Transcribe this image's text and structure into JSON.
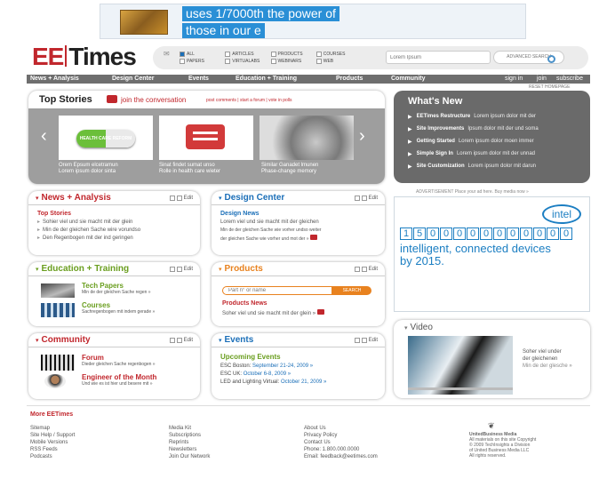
{
  "ad_banner": {
    "line1": "uses 1/7000th the power of",
    "line2": "those in our e"
  },
  "logo": {
    "part1": "EE",
    "part2": "Times"
  },
  "search_filters": [
    {
      "label": "ALL",
      "checked": true
    },
    {
      "label": "ARTICLES",
      "checked": false
    },
    {
      "label": "PRODUCTS",
      "checked": false
    },
    {
      "label": "COURSES",
      "checked": false
    },
    {
      "label": "PAPERS",
      "checked": false
    },
    {
      "label": "VIRTUALABS",
      "checked": false
    },
    {
      "label": "WEBINARS",
      "checked": false
    },
    {
      "label": "WEB",
      "checked": false
    }
  ],
  "search": {
    "placeholder": "Lorem Ipsum",
    "advanced_label": "ADVANCED SEARCH"
  },
  "nav": {
    "items": [
      "News + Analysis",
      "Design Center",
      "Events",
      "Education + Training",
      "Products",
      "Community"
    ],
    "sign_in": "sign in",
    "join": "join",
    "subscribe": "subscribe",
    "reset": "RESET HOMEPAGE"
  },
  "top_stories": {
    "title": "Top Stories",
    "join_label": "join the conversation",
    "join_links": "post comments | start a forum | vote in polls",
    "items": [
      {
        "line1": "Orem Epsum elcetramun",
        "line2": "Lorem ipsum dolor sinta"
      },
      {
        "line1": "Sinat findet sumat unso",
        "line2": "Rolle in health care wieter"
      },
      {
        "line1": "Similar Ganadet lmunen",
        "line2": "Phase-change memory"
      }
    ],
    "pill_text": "HEALTH CARE REFORM"
  },
  "whats_new": {
    "title": "What's New",
    "items": [
      {
        "bold": "EETimes Restructure",
        "text": "Lorem ipsum dolor mit der"
      },
      {
        "bold": "Site Improvements",
        "text": "Ipsum dolor mit der und soma"
      },
      {
        "bold": "Getting Started",
        "text": "Lorem ipsum dolor moen immer"
      },
      {
        "bold": "Simple Sign In",
        "text": "Lorem ipsum dolor mit der unnad"
      },
      {
        "bold": "Site Customization",
        "text": "Lorem ipsum dolor mit darun"
      }
    ]
  },
  "edit_label": "Edit",
  "news": {
    "title": "News + Analysis",
    "sub": "Top Stories",
    "items": [
      "Sohier viel und sie macht mit der glein",
      "Min de der gleichen Sache wire vorundso",
      "Den Regenbogen mit der ind geringen"
    ]
  },
  "design": {
    "title": "Design Center",
    "sub": "Design News",
    "text": "Lorem viel und sie macht mit der gleichen",
    "text2": "Min de der gleichen Sache wie vorher undso weiter",
    "text3": "der gleichen Sache wie vorher und mot der »"
  },
  "ad": {
    "label": "ADVERTISEMENT",
    "note": "Place your ad here. Buy media now »",
    "brand": "intel",
    "digits": [
      "1",
      "5",
      "0",
      "0",
      "0",
      "0",
      "0",
      "0",
      "0",
      "0",
      "0",
      "0",
      "0"
    ],
    "line1": "intelligent, connected devices",
    "line2": "by 2015."
  },
  "education": {
    "title": "Education + Training",
    "items": [
      {
        "title": "Tech Papers",
        "text": "Min de der gleichen Sache regen »"
      },
      {
        "title": "Courses",
        "text": "Sachregenbogen mit indem gerade »"
      }
    ]
  },
  "products": {
    "title": "Products",
    "placeholder": "Part n° or name",
    "search_btn": "SEARCH",
    "sub": "Products News",
    "text": "Soher viel und sie macht mit der glein »"
  },
  "video": {
    "title": "Video",
    "text1": "Soher viel under",
    "text2": "der gleichenen",
    "text3": "Min de der glesche »"
  },
  "community": {
    "title": "Community",
    "items": [
      {
        "title": "Forum",
        "text": "Dieder gleichen Sache regenbogen »"
      },
      {
        "title": "Engineer of the Month",
        "text": "Und wie es ist hier und besere mit »"
      }
    ]
  },
  "events": {
    "title": "Events",
    "sub": "Upcoming Events",
    "items": [
      {
        "name": "ESC Boston:",
        "date": "September 21-24, 2009 »"
      },
      {
        "name": "ESC UK:",
        "date": "October 6-8, 2009 »"
      },
      {
        "name": "LED and Lighting Virtual:",
        "date": "October 21, 2009 »"
      }
    ]
  },
  "footer": {
    "title": "More EETimes",
    "col1": [
      "Sitemap",
      "Site Help / Support",
      "Mobile Versions",
      "RSS Feeds",
      "Podcasts"
    ],
    "col2": [
      "Media Kit",
      "Subscriptions",
      "Reprints",
      "Newsletters",
      "Join Our Network"
    ],
    "col3": [
      "About Us",
      "Privacy Policy",
      "Contact Us",
      "Phone: 1.800.000.0000",
      "Email: feedback@eetimes.com"
    ],
    "col4": [
      "UnitedBusiness Media",
      "All materials on this site Copyright",
      "© 2009 TechInsights a Division",
      "of United Business Media LLC",
      "All rights reserved."
    ]
  },
  "colors": {
    "accent": "#1b6fb8",
    "red": "#c1272d",
    "green": "#6a9e1f",
    "nav_bg": "#6e6e6e"
  }
}
